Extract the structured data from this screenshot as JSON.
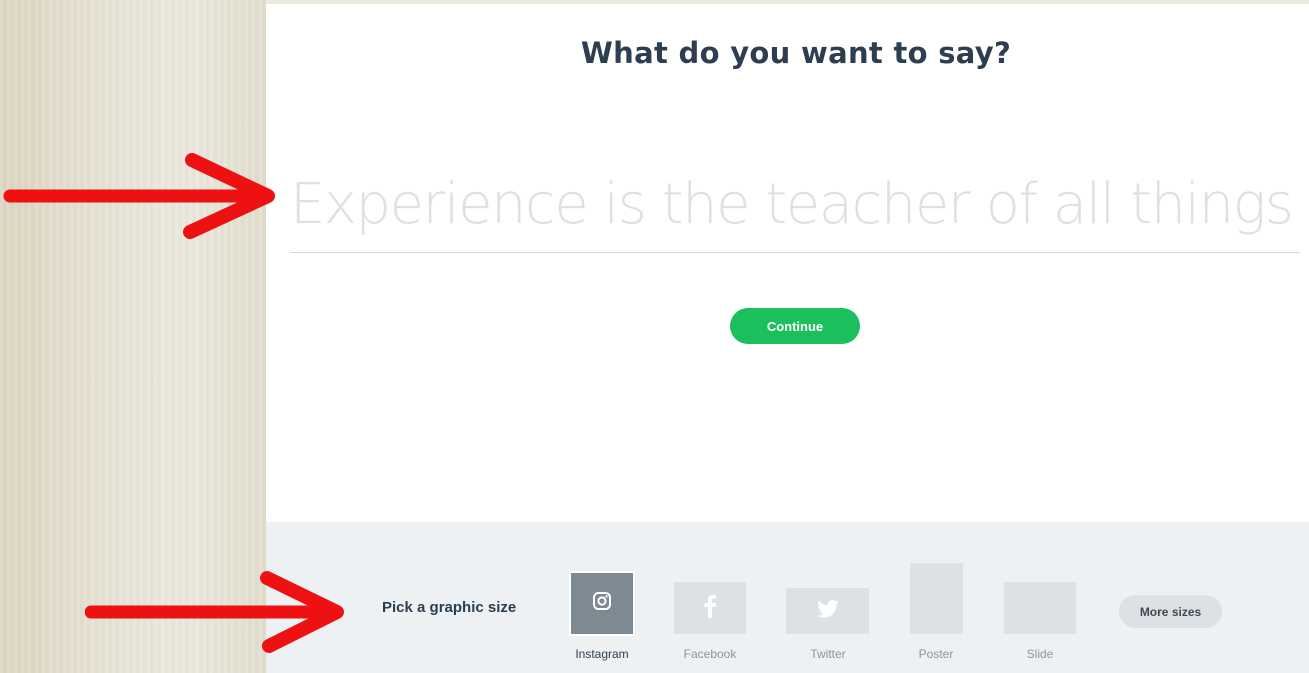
{
  "main": {
    "heading": "What do you want to say?",
    "phrase": {
      "value": "",
      "placeholder": "Experience is the teacher of all things"
    },
    "continue_label": "Continue"
  },
  "footer": {
    "pick_label": "Pick a graphic size",
    "sizes": [
      {
        "label": "Instagram",
        "icon": "instagram-icon",
        "selected": true
      },
      {
        "label": "Facebook",
        "icon": "facebook-icon",
        "selected": false
      },
      {
        "label": "Twitter",
        "icon": "twitter-icon",
        "selected": false
      },
      {
        "label": "Poster",
        "icon": "",
        "selected": false
      },
      {
        "label": "Slide",
        "icon": "",
        "selected": false
      }
    ],
    "more_label": "More sizes"
  },
  "colors": {
    "accent_green": "#1bbf5c",
    "heading_navy": "#2c3e50",
    "annotation_red": "#ee1111"
  }
}
